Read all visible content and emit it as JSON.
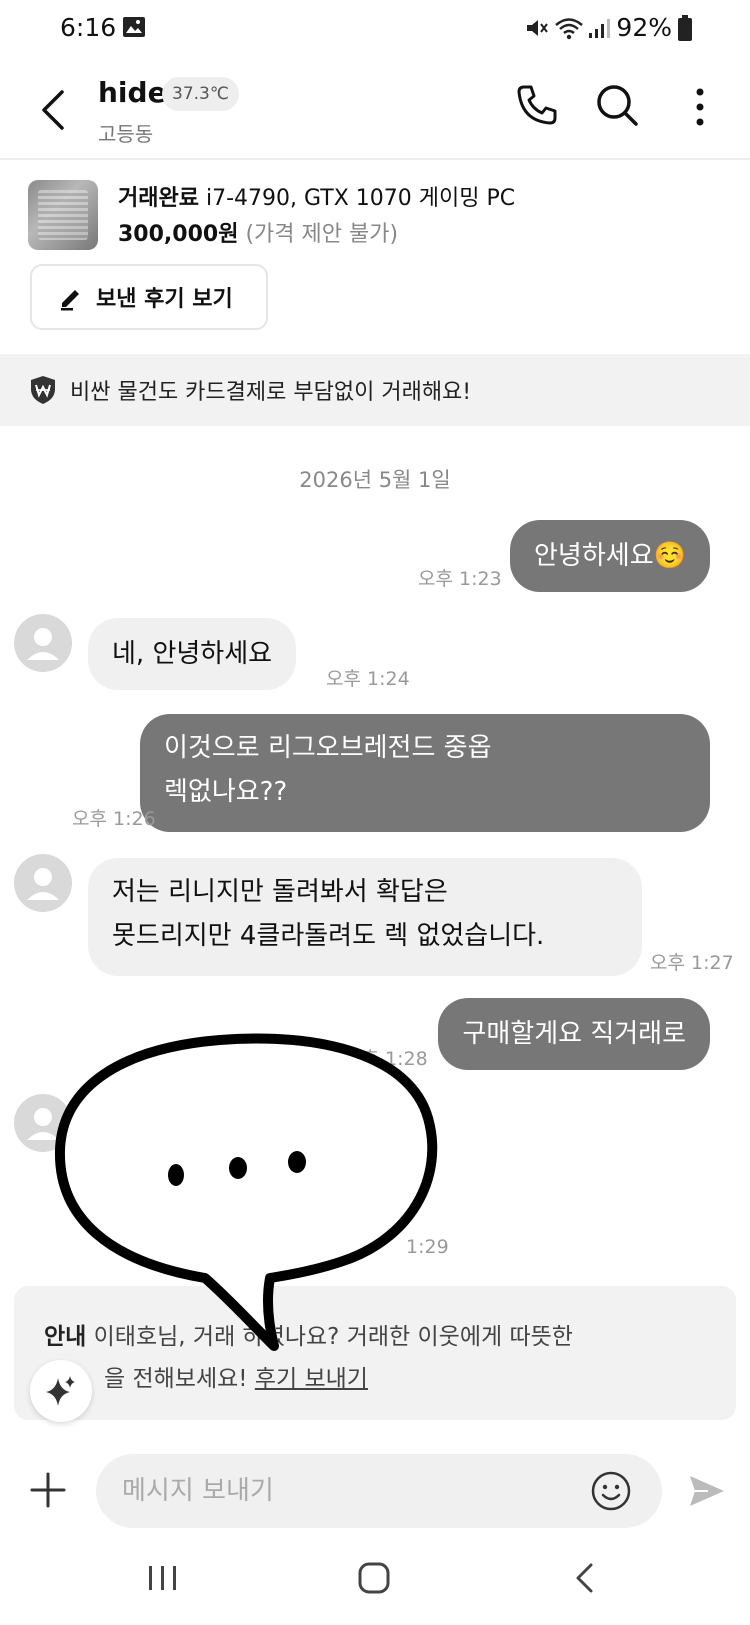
{
  "status_bar": {
    "time": "6:16",
    "battery": "92%"
  },
  "header": {
    "name": "hide",
    "temperature": "37.3℃",
    "location": "고등동"
  },
  "product": {
    "status": "거래완료",
    "title": "i7-4790, GTX 1070 게이밍 PC",
    "price": "300,000원",
    "price_note": "(가격 제안 불가)",
    "review_button": "보낸 후기 보기"
  },
  "promo": {
    "text": "비싼 물건도 카드결제로 부담없이 거래해요!"
  },
  "chat": {
    "date": "2026년 5월 1일",
    "messages": [
      {
        "dir": "out",
        "lines": [
          "안녕하세요☺️"
        ],
        "time": "오후 1:23"
      },
      {
        "dir": "in",
        "lines": [
          "네, 안녕하세요"
        ],
        "time": "오후 1:24"
      },
      {
        "dir": "out",
        "lines": [
          "이것으로 리그오브레전드 중옵",
          "렉없나요??"
        ],
        "time": "오후 1:26"
      },
      {
        "dir": "in",
        "lines": [
          "저는 리니지만 돌려봐서 확답은",
          "못드리지만 4클라돌려도 렉 없었습니다."
        ],
        "time": "오후 1:27"
      },
      {
        "dir": "out",
        "lines": [
          "구매할게요 직거래로"
        ],
        "time": "오후 1:28"
      },
      {
        "dir": "in",
        "lines": [
          ""
        ],
        "time": "1:29"
      }
    ]
  },
  "notice": {
    "label": "안내",
    "text_a": "이태호님, 거래",
    "text_b": "하셨나요? 거래한 이웃에게 따뜻한",
    "text_c": "을 전해보세요!",
    "link": "후기 보내기"
  },
  "input": {
    "placeholder": "메시지 보내기"
  },
  "colors": {
    "outgoing_bubble": "#777777",
    "incoming_bubble": "#f0f0f0",
    "banner_bg": "#f2f2f2"
  }
}
